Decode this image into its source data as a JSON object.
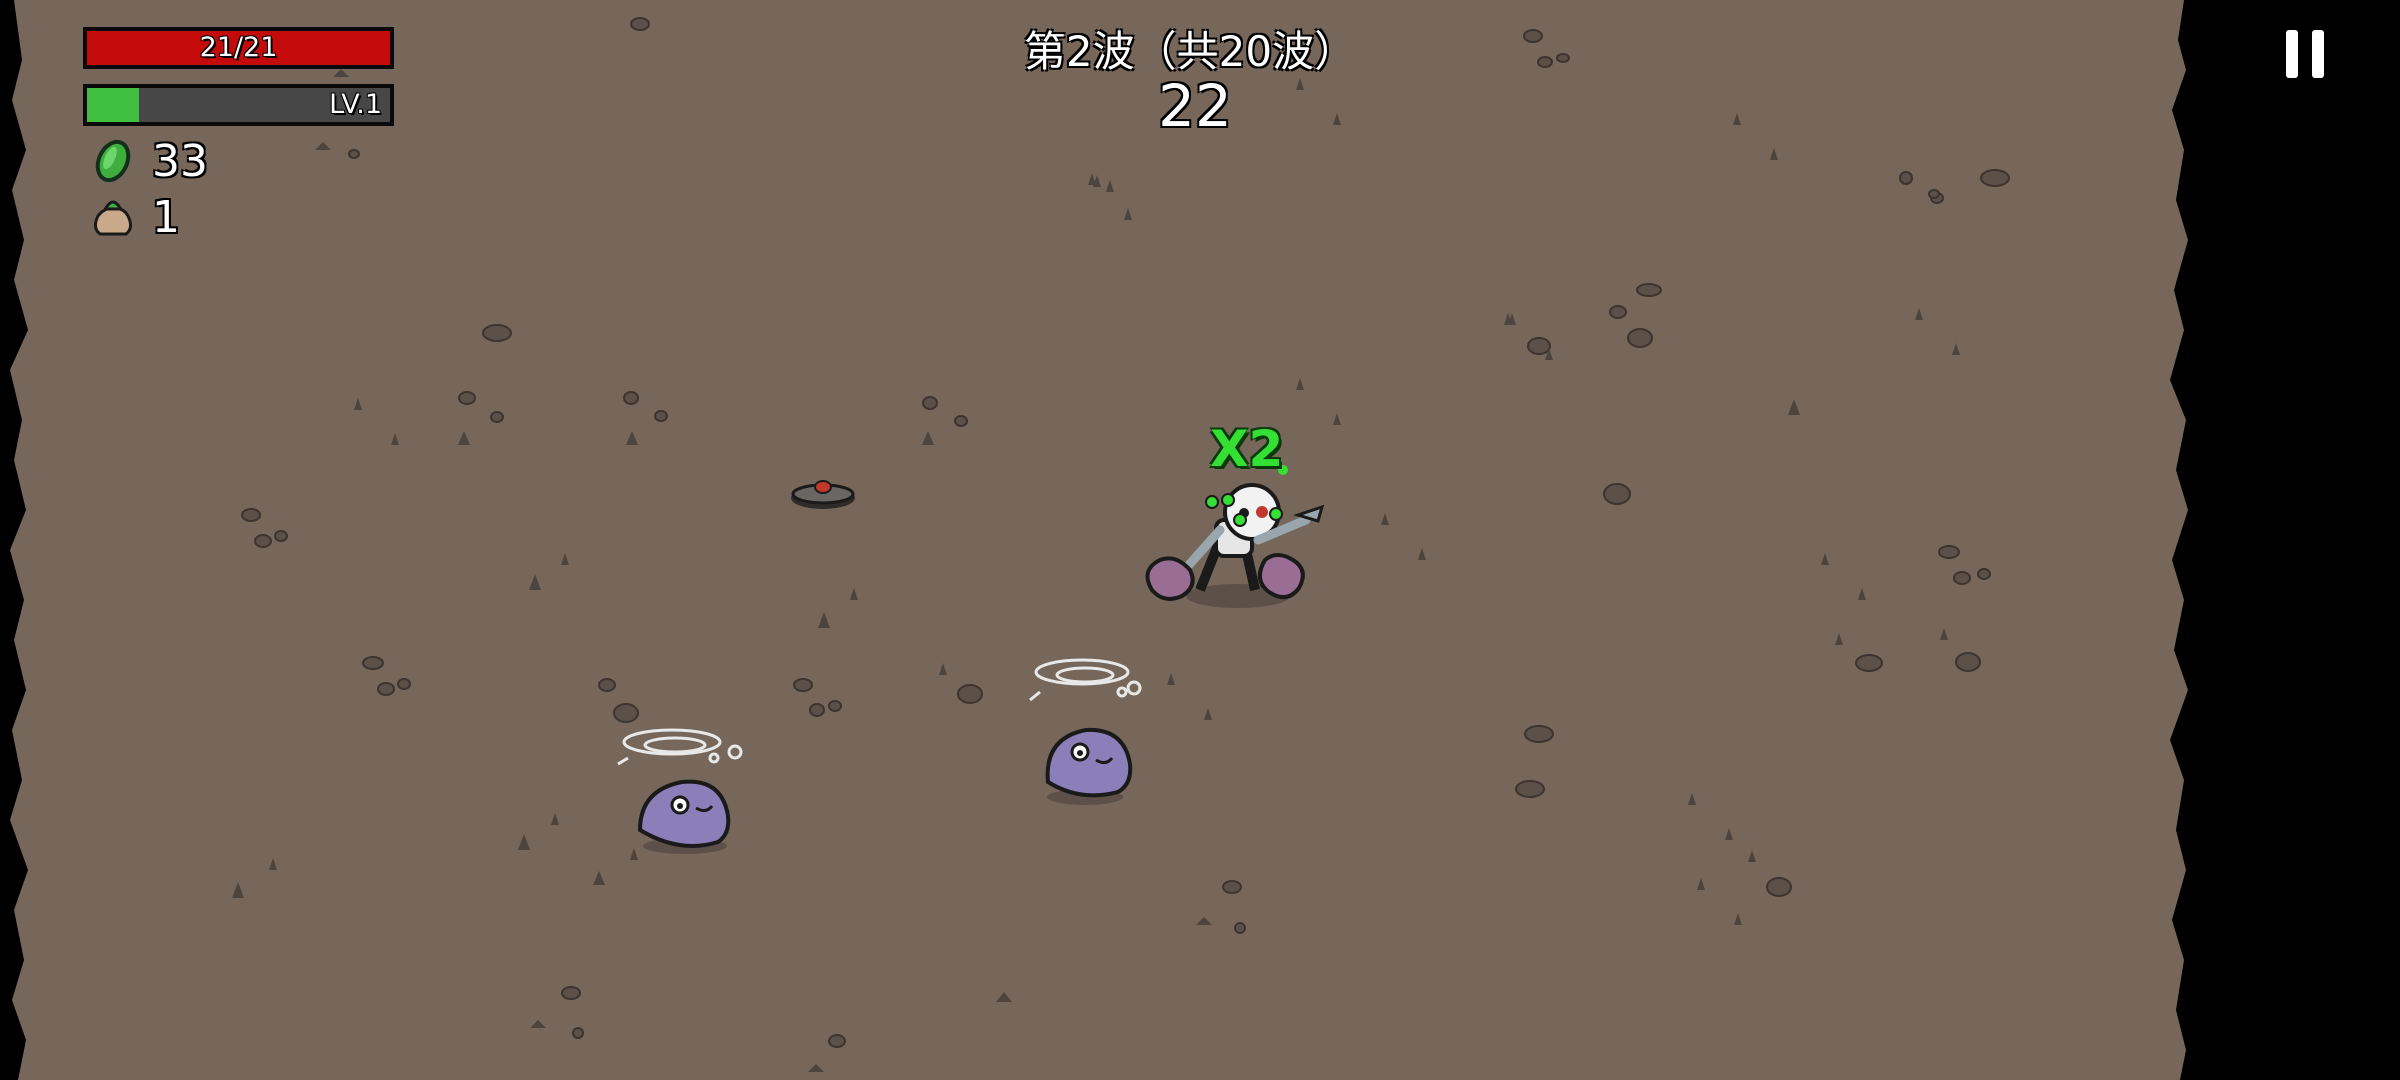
{
  "hud": {
    "hp_text": "21/21",
    "hp_fraction": 1.0,
    "xp_level_text": "LV.1",
    "xp_fraction": 0.17,
    "materials_count": "33",
    "bag_count": "1"
  },
  "wave": {
    "title": "第2波（共20波）",
    "timer": "22"
  },
  "player": {
    "combo_text": "X2"
  },
  "colors": {
    "ground": "#76675a",
    "hp": "#c40a0a",
    "xp": "#3fbe3f",
    "enemy": "#8a7fb8",
    "combo": "#35e035"
  },
  "icons": [
    "materials-icon",
    "loot-bag-icon",
    "pause-icon",
    "landmine-icon"
  ]
}
